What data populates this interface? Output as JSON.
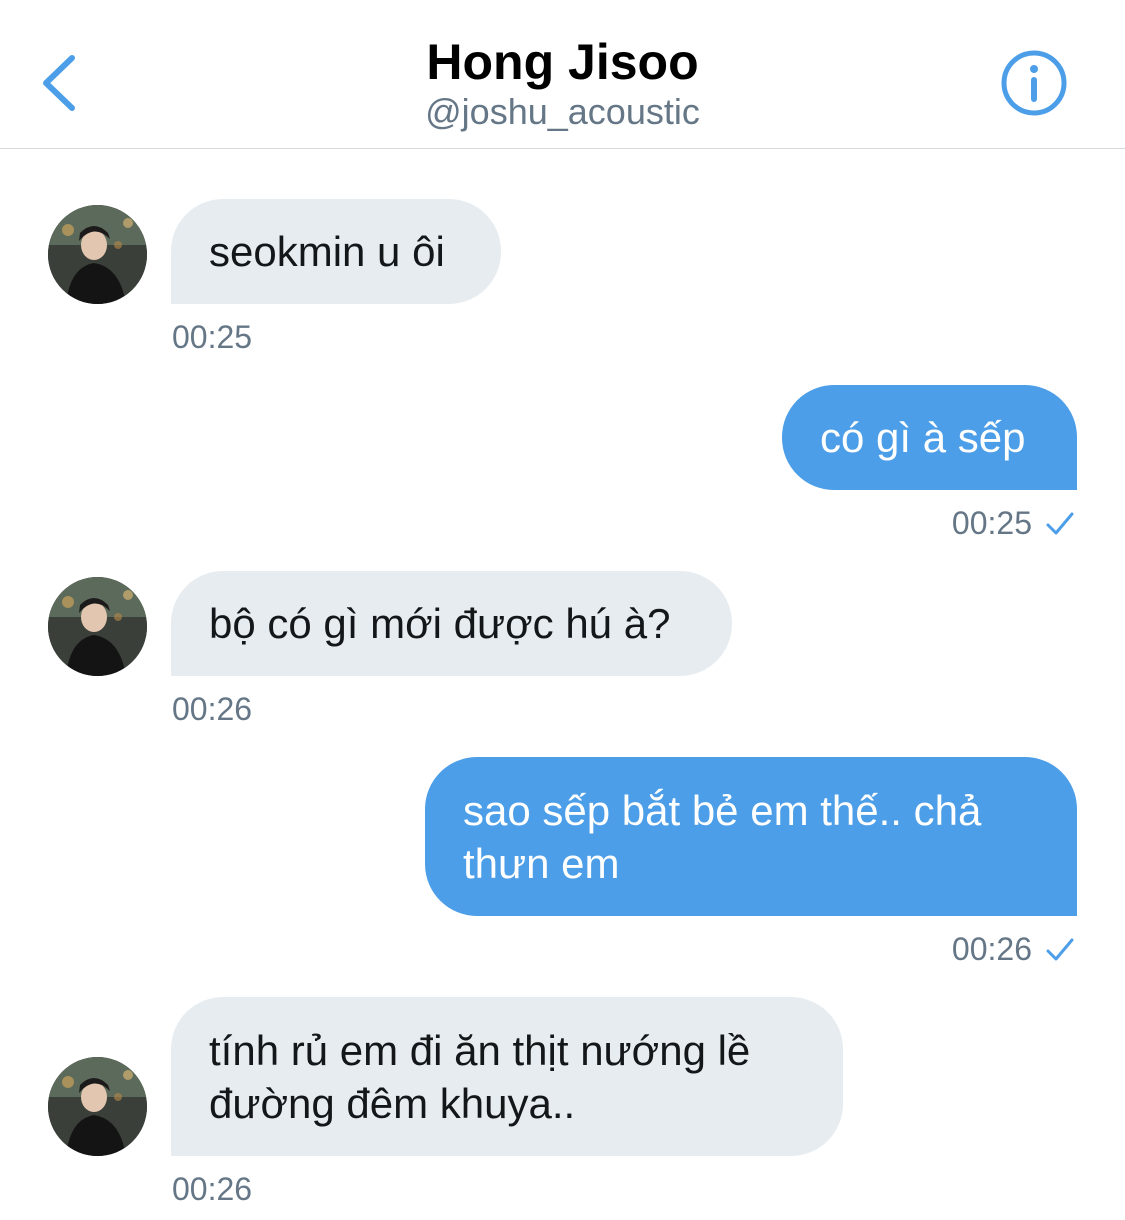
{
  "header": {
    "title": "Hong Jisoo",
    "handle": "@joshu_acoustic",
    "back_icon": "chevron-left-icon",
    "info_icon": "info-circle-icon"
  },
  "colors": {
    "accent": "#4c9ee8",
    "incoming_bubble": "#e6ecf0",
    "timestamp": "#657786"
  },
  "messages": [
    {
      "direction": "incoming",
      "text": "seokmin u ôi",
      "time": "00:25"
    },
    {
      "direction": "outgoing",
      "text": "có gì à sếp",
      "time": "00:25",
      "status_icon": "check-icon"
    },
    {
      "direction": "incoming",
      "text": "bộ có gì mới được hú à?",
      "time": "00:26"
    },
    {
      "direction": "outgoing",
      "text_lines": [
        "sao sếp bắt bẻ em thế.. chả",
        "thưn em"
      ],
      "time": "00:26",
      "status_icon": "check-icon"
    },
    {
      "direction": "incoming",
      "text_lines": [
        "tính rủ em đi ăn thịt nướng lề",
        "đường đêm khuya.."
      ],
      "time": "00:26"
    }
  ]
}
